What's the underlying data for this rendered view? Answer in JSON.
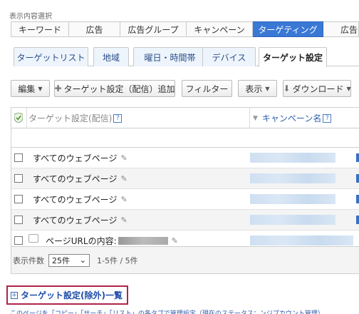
{
  "header": {
    "section_label": "表示内容選択"
  },
  "top_tabs": [
    {
      "label": "キーワード",
      "active": false
    },
    {
      "label": "広告",
      "active": false
    },
    {
      "label": "広告グループ",
      "active": false
    },
    {
      "label": "キャンペーン",
      "active": false
    },
    {
      "label": "ターゲティング",
      "active": true
    },
    {
      "label": "広告",
      "active": false
    }
  ],
  "sub_tabs": [
    {
      "label": "ターゲットリスト",
      "active": false
    },
    {
      "label": "地域",
      "active": false
    },
    {
      "label": "曜日・時間帯",
      "active": false
    },
    {
      "label": "デバイス",
      "active": false
    },
    {
      "label": "ターゲット設定",
      "active": true
    }
  ],
  "toolbar": {
    "edit": "編集",
    "add": "ターゲット設定（配信）追加",
    "filter": "フィルター",
    "display": "表示",
    "download": "ダウンロード"
  },
  "table": {
    "col_target": "ターゲット設定(配信)",
    "col_campaign": "キャンペーン名",
    "help_glyph": "?",
    "rows": [
      {
        "name": "すべてのウェブページ"
      },
      {
        "name": "すべてのウェブページ"
      },
      {
        "name": "すべてのウェブページ"
      },
      {
        "name": "すべてのウェブページ"
      },
      {
        "name": "ページURLの内容:"
      }
    ]
  },
  "pager": {
    "label": "表示件数",
    "per_page": "25件",
    "range": "1-5件 / 5件"
  },
  "exclusion": {
    "link": "ターゲット設定(除外)一覧",
    "toggle_glyph": "+"
  },
  "footer": {
    "text": "このページを「コピー」「サーチ」「リスト」の各タブで管理設定（現在のステータス：ンジプカウント管理）"
  },
  "colors": {
    "accent": "#3a78d6",
    "highlight_border": "#b0244a",
    "link": "#1f4da8"
  }
}
